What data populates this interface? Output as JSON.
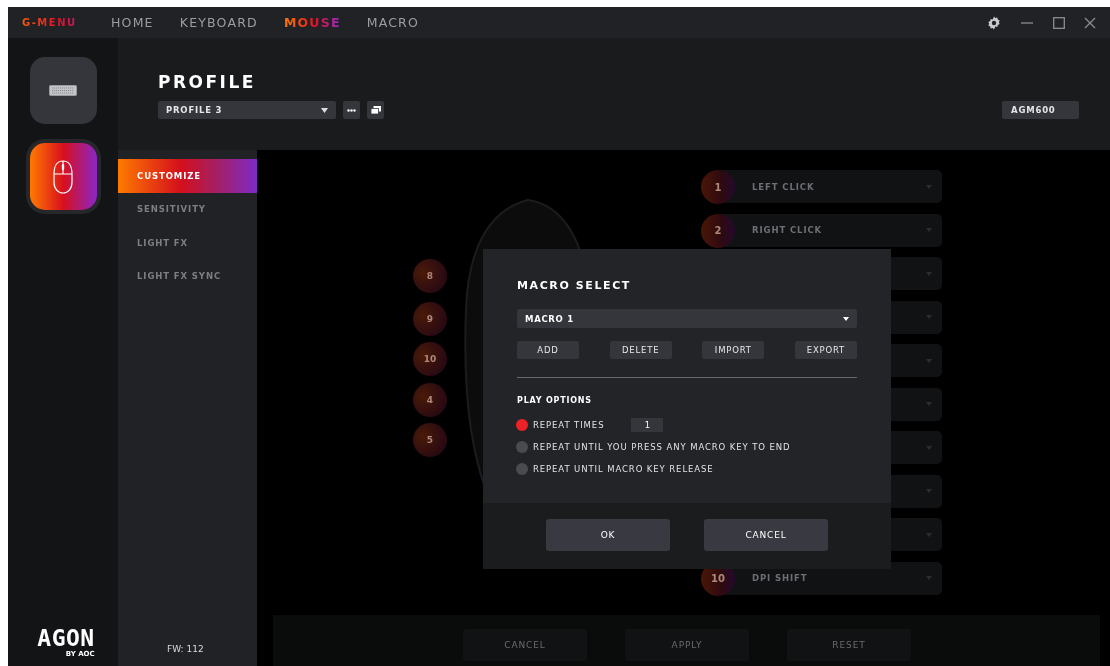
{
  "titlebar": {
    "logo": "G-MENU",
    "tabs": [
      {
        "label": "HOME",
        "selected": false
      },
      {
        "label": "KEYBOARD",
        "selected": false
      },
      {
        "label": "MOUSE",
        "selected": true
      },
      {
        "label": "MACRO",
        "selected": false
      }
    ]
  },
  "devices": [
    {
      "kind": "keyboard",
      "selected": false
    },
    {
      "kind": "mouse",
      "selected": true
    }
  ],
  "profile": {
    "title": "PROFILE",
    "value": "PROFILE 3",
    "device": "AGM600"
  },
  "subnav": [
    {
      "label": "CUSTOMIZE",
      "selected": true
    },
    {
      "label": "SENSITIVITY",
      "selected": false
    },
    {
      "label": "LIGHT FX",
      "selected": false
    },
    {
      "label": "LIGHT FX SYNC",
      "selected": false
    }
  ],
  "brand": {
    "name": "AGON",
    "by": "BY AOC"
  },
  "firmware": "FW: 112",
  "side_buttons": [
    "8",
    "9",
    "10",
    "4",
    "5"
  ],
  "mappings": [
    {
      "kind": "labeled",
      "number": "1",
      "label": "LEFT CLICK"
    },
    {
      "kind": "labeled",
      "number": "2",
      "label": "RIGHT CLICK"
    },
    {
      "kind": "covered"
    },
    {
      "kind": "covered"
    },
    {
      "kind": "covered"
    },
    {
      "kind": "covered"
    },
    {
      "kind": "covered"
    },
    {
      "kind": "covered"
    },
    {
      "kind": "covered"
    },
    {
      "kind": "labeled",
      "number": "10",
      "label": "DPI SHIFT"
    }
  ],
  "footer_buttons": [
    "CANCEL",
    "APPLY",
    "RESET"
  ],
  "dialog": {
    "title": "MACRO SELECT",
    "macro": "MACRO 1",
    "actions": [
      "ADD",
      "DELETE",
      "IMPORT",
      "EXPORT"
    ],
    "play_title": "PLAY OPTIONS",
    "options": [
      {
        "label": "REPEAT TIMES",
        "selected": true,
        "count": "1"
      },
      {
        "label": "REPEAT UNTIL YOU PRESS ANY MACRO KEY TO END",
        "selected": false
      },
      {
        "label": "REPEAT UNTIL MACRO KEY RELEASE",
        "selected": false
      }
    ],
    "buttons": [
      "OK",
      "CANCEL"
    ]
  }
}
